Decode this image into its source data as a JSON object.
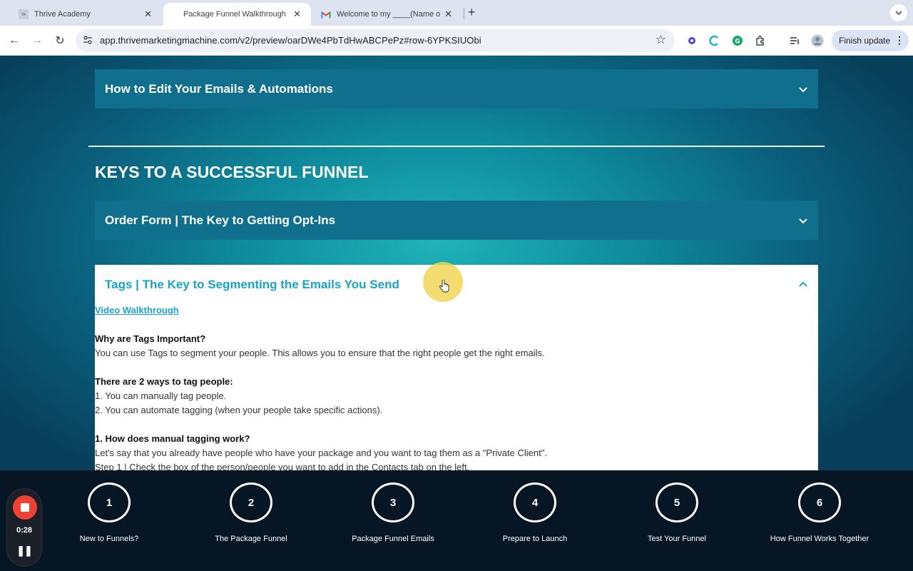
{
  "browser": {
    "tabs": [
      {
        "title": "Thrive Academy"
      },
      {
        "title": "Package Funnel Walkthrough"
      },
      {
        "title": "Welcome to my ____(Name o"
      }
    ],
    "url": "app.thrivemarketingmachine.com/v2/preview/oarDWe4PbTdHwABCPePz#row-6YPKSIUObi",
    "finish_update_label": "Finish update"
  },
  "page": {
    "accordions_top": [
      {
        "title": "How to Edit Your Emails & Automations"
      }
    ],
    "section_title": "KEYS TO A SUCCESSFUL FUNNEL",
    "accordions_section": [
      {
        "title": "Order Form | The Key to Getting Opt-Ins"
      }
    ],
    "open_panel": {
      "title": "Tags | The Key to Segmenting the Emails You Send",
      "video_link": "Video Walkthrough",
      "lines": [
        {
          "text": "Why are Tags Important?",
          "bold": true
        },
        {
          "text": "You can use Tags to segment your people. This allows you to ensure that the right people get the right emails.",
          "bold": false
        },
        {
          "text": "There are 2 ways to tag people:",
          "bold": true
        },
        {
          "text": "1. You can manually tag people.",
          "bold": false
        },
        {
          "text": "2. You can automate tagging (when your people take specific actions).",
          "bold": false
        },
        {
          "text": "1. How does manual tagging work?",
          "bold": true
        },
        {
          "text": "Let's say that you already have people who have your package and you want to tag them as a \"Private Client\".",
          "bold": false
        },
        {
          "text": "Step 1 | Check the box of the person/people you want to add in the Contacts tab on the left.",
          "bold": false
        }
      ]
    }
  },
  "recorder": {
    "time": "0:28",
    "pause_symbol": "❚❚"
  },
  "steps": [
    {
      "number": "1",
      "label": "New to Funnels?"
    },
    {
      "number": "2",
      "label": "The Package Funnel"
    },
    {
      "number": "3",
      "label": "Package Funnel Emails"
    },
    {
      "number": "4",
      "label": "Prepare to Launch"
    },
    {
      "number": "5",
      "label": "Test Your Funnel"
    },
    {
      "number": "6",
      "label": "How Funnel Works Together"
    }
  ]
}
